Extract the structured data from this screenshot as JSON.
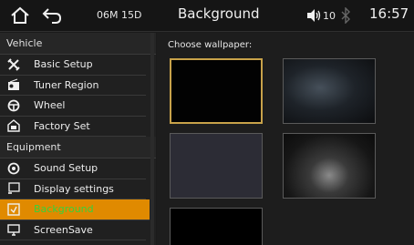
{
  "topbar": {
    "home_icon": "home-icon",
    "back_icon": "back-arrow-icon",
    "radio": "06M 15D",
    "title": "Background",
    "volume": "10",
    "clock": "16:57"
  },
  "sidebar": {
    "sections": [
      {
        "title": "Vehicle",
        "items": [
          {
            "label": "Basic Setup",
            "icon": "tools-icon"
          },
          {
            "label": "Tuner Region",
            "icon": "radio-icon"
          },
          {
            "label": "Wheel",
            "icon": "steering-wheel-icon"
          },
          {
            "label": "Factory Set",
            "icon": "factory-set-icon"
          }
        ]
      },
      {
        "title": "Equipment",
        "items": [
          {
            "label": "Sound Setup",
            "icon": "sound-icon"
          },
          {
            "label": "Display settings",
            "icon": "display-icon"
          },
          {
            "label": "Background",
            "icon": "background-icon",
            "active": true
          },
          {
            "label": "ScreenSave",
            "icon": "monitor-icon"
          }
        ]
      }
    ]
  },
  "main": {
    "choose_label": "Choose wallpaper:",
    "selected_index": 0
  },
  "colors": {
    "active_bg": "#e08a00",
    "active_text": "#38d23a",
    "selected_border": "#c8a24a"
  }
}
